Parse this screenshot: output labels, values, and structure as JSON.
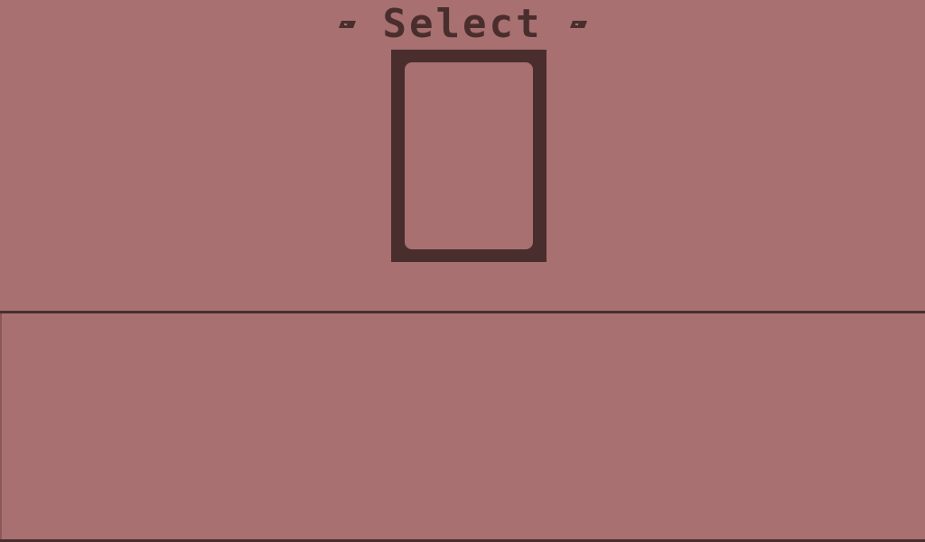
{
  "header": {
    "title": "Select"
  },
  "icons": {
    "left_deco": "double-dash-icon",
    "right_deco": "double-dash-icon"
  },
  "card_slot": {
    "state": "empty"
  },
  "colors": {
    "background": "#a87070",
    "ink": "#4a2e2e"
  }
}
